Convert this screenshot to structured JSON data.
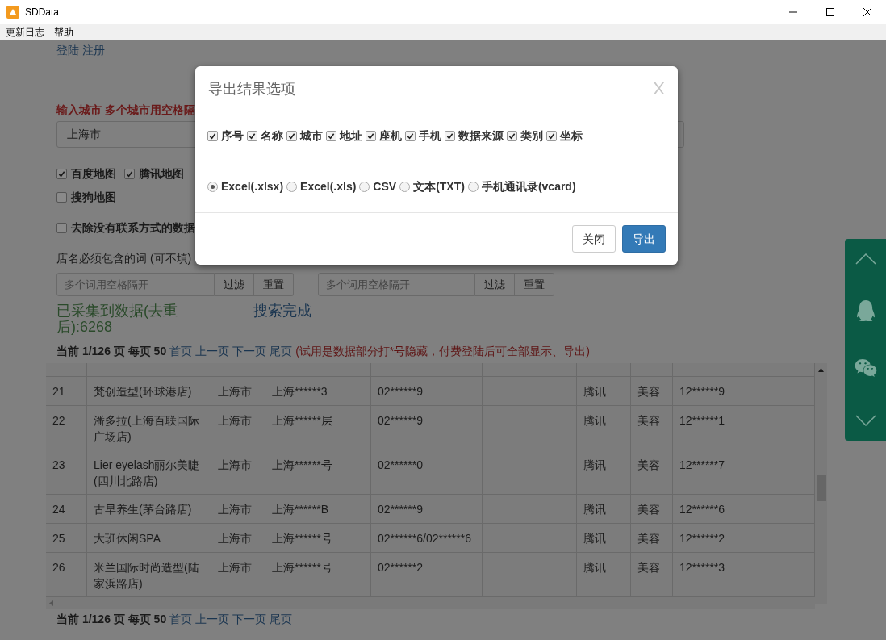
{
  "window": {
    "title": "SDData"
  },
  "menu": [
    "更新日志",
    "帮助"
  ],
  "page": {
    "auth_links": [
      "登陆",
      "注册"
    ],
    "city_label": "输入城市 多个城市用空格隔",
    "city_value": "上海市",
    "sources": [
      {
        "label": "百度地图",
        "checked": true
      },
      {
        "label": "腾讯地图",
        "checked": true
      },
      {
        "label": "搜狗地图",
        "checked": false
      }
    ],
    "remove_no_contact": {
      "label": "去除没有联系方式的数据",
      "checked": false
    },
    "include_filter": {
      "label": "店名必须包含的词 (可不填)",
      "placeholder": "多个词用空格隔开",
      "buttons": [
        "过滤",
        "重置"
      ]
    },
    "exclude_filter": {
      "placeholder": "多个词用空格隔开",
      "buttons": [
        "过滤",
        "重置"
      ]
    },
    "collected": "已采集到数据(去重后):6268",
    "status": "搜索完成",
    "pagination": {
      "info": "当前 1/126 页 每页 50",
      "links": [
        "首页",
        "上一页",
        "下一页",
        "尾页"
      ],
      "note": "(试用是数据部分打*号隐藏，付费登陆后可全部显示、导出)"
    },
    "table": {
      "rows": [
        [
          "21",
          "梵创造型(环球港店)",
          "上海市",
          "上海******3",
          "02******9",
          "",
          "腾讯",
          "美容",
          "12******9"
        ],
        [
          "22",
          "潘多拉(上海百联国际广场店)",
          "上海市",
          "上海******层",
          "02******9",
          "",
          "腾讯",
          "美容",
          "12******1"
        ],
        [
          "23",
          "Lier eyelash丽尔美睫(四川北路店)",
          "上海市",
          "上海******号",
          "02******0",
          "",
          "腾讯",
          "美容",
          "12******7"
        ],
        [
          "24",
          "古早养生(茅台路店)",
          "上海市",
          "上海******B",
          "02******9",
          "",
          "腾讯",
          "美容",
          "12******6"
        ],
        [
          "25",
          "大班休闲SPA",
          "上海市",
          "上海******号",
          "02******6/02******6",
          "",
          "腾讯",
          "美容",
          "12******2"
        ],
        [
          "26",
          "米兰国际时尚造型(陆家浜路店)",
          "上海市",
          "上海******号",
          "02******2",
          "",
          "腾讯",
          "美容",
          "12******3"
        ]
      ]
    },
    "pagination_bottom": {
      "info": "当前 1/126 页 每页 50",
      "links": [
        "首页",
        "上一页",
        "下一页",
        "尾页"
      ]
    }
  },
  "modal": {
    "title": "导出结果选项",
    "close": "X",
    "fields": [
      {
        "label": "序号",
        "checked": true
      },
      {
        "label": "名称",
        "checked": true
      },
      {
        "label": "城市",
        "checked": true
      },
      {
        "label": "地址",
        "checked": true
      },
      {
        "label": "座机",
        "checked": true
      },
      {
        "label": "手机",
        "checked": true
      },
      {
        "label": "数据来源",
        "checked": true
      },
      {
        "label": "类别",
        "checked": true
      },
      {
        "label": "坐标",
        "checked": true
      }
    ],
    "formats": [
      {
        "label": "Excel(.xlsx)",
        "selected": true
      },
      {
        "label": "Excel(.xls)",
        "selected": false
      },
      {
        "label": "CSV",
        "selected": false
      },
      {
        "label": "文本(TXT)",
        "selected": false
      },
      {
        "label": "手机通讯录(vcard)",
        "selected": false
      }
    ],
    "buttons": [
      {
        "label": "关闭",
        "kind": "default"
      },
      {
        "label": "导出",
        "kind": "primary"
      }
    ]
  }
}
